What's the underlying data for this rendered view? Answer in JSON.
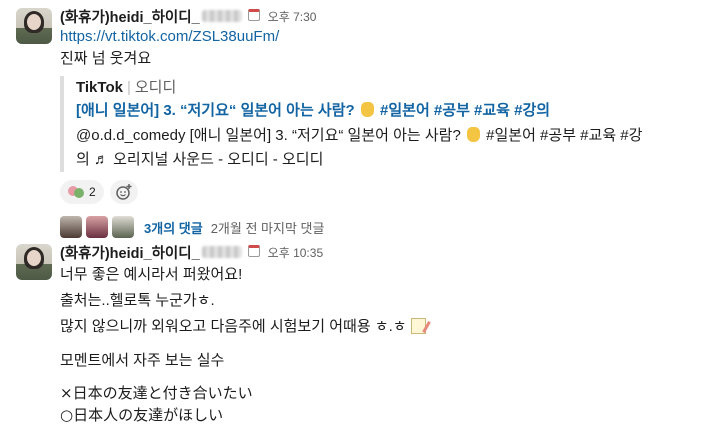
{
  "messages": [
    {
      "sender": "(화휴가)heidi_하이디_",
      "time": "오후 7:30",
      "link": "https://vt.tiktok.com/ZSL38uuFm/",
      "text": "진짜 넘 웃겨요",
      "unfurl": {
        "source": "TikTok",
        "author": "오디디",
        "title_before": "[애니 일본어] 3. “저기요“ 일본어 아는 사람? ",
        "title_after": " #일본어 #공부 #교육 #강의",
        "desc_line1_before": "@o.d.d_comedy [애니 일본어] 3. “저기요“ 일본어 아는 사람? ",
        "desc_line1_after": " #일본어 #공부 #교육 #강",
        "desc_line2": "의  ♬ 오리지널 사운드 - 오디디 - 오디디"
      },
      "reaction_count": "2",
      "thread": {
        "count_label": "3개의 댓글",
        "last_reply": "2개월 전 마지막 댓글"
      }
    },
    {
      "sender": "(화휴가)heidi_하이디_",
      "time": "오후 10:35",
      "lines": [
        "너무 좋은 예시라서 퍼왔어요!",
        "출처는..헬로톡 누군가ㅎ.",
        "많지 않으니까 외워오고 다음주에 시험보기 어때용 ㅎ.ㅎ",
        "모멘트에서 자주 보는 실수",
        "×日本の友達と付き合いたい",
        "○日本人の友達がほしい"
      ]
    }
  ]
}
